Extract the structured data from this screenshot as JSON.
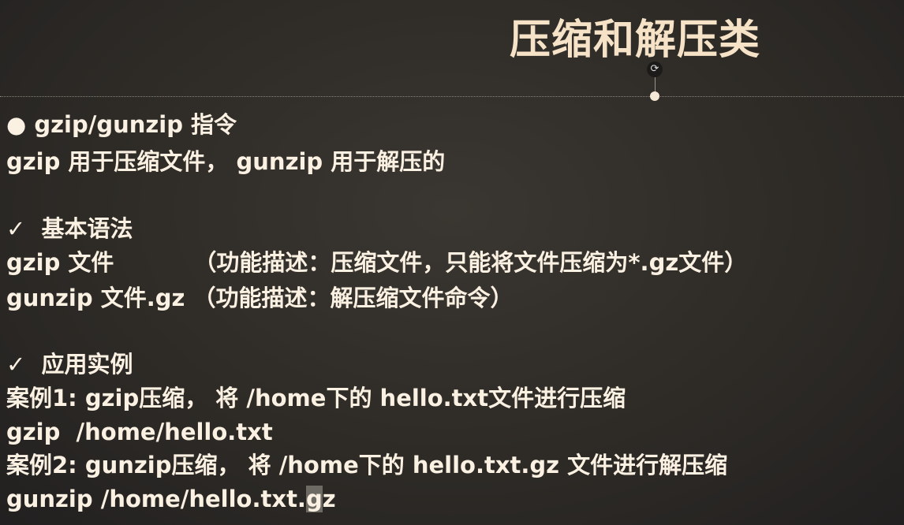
{
  "title": "压缩和解压类",
  "lines": {
    "heading": "● gzip/gunzip 指令",
    "desc": "gzip 用于压缩文件， gunzip 用于解压的",
    "syntax_head": "✓  基本语法",
    "syntax1": "gzip 文件          （功能描述：压缩文件，只能将文件压缩为*.gz文件）",
    "syntax2": "gunzip 文件.gz （功能描述：解压缩文件命令）",
    "example_head": "✓  应用实例",
    "case1": "案例1: gzip压缩， 将 /home下的 hello.txt文件进行压缩",
    "cmd1": "gzip  /home/hello.txt",
    "case2": "案例2: gunzip压缩， 将 /home下的 hello.txt.gz 文件进行解压缩",
    "cmd2_pre": "gunzip /home/hello.txt.",
    "cmd2_sel": "g",
    "cmd2_post": "z"
  }
}
